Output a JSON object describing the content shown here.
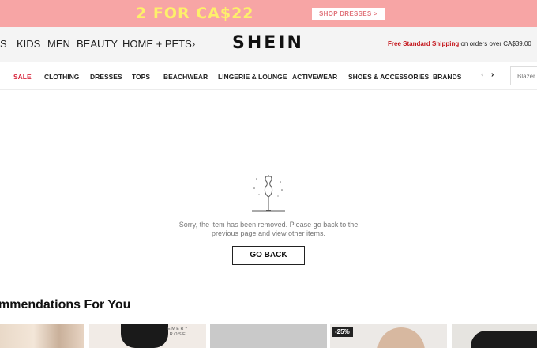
{
  "promo": {
    "headline": "2 FOR CA$22",
    "button_label": "SHOP DRESSES >"
  },
  "header": {
    "nav": [
      "S",
      "KIDS",
      "MEN",
      "BEAUTY",
      "HOME + PETS"
    ],
    "nav_next": "›",
    "logo": "SHEIN",
    "shipping_free": "Free Standard Shipping",
    "shipping_rest": " on orders over CA$39.00"
  },
  "categories": [
    "SALE",
    "CLOTHING",
    "DRESSES",
    "TOPS",
    "BEACHWEAR",
    "LINGERIE & LOUNGE",
    "ACTIVEWEAR",
    "SHOES & ACCESSORIES",
    "BRANDS"
  ],
  "category_nav": {
    "prev": "‹",
    "next": "›"
  },
  "search": {
    "placeholder": "Blazer"
  },
  "empty_state": {
    "message_line1": "Sorry, the item has been removed. Please go back to the",
    "message_line2": "previous page and view other items.",
    "button_label": "GO BACK"
  },
  "recommendations": {
    "title": "mmendations For You",
    "brand_line1": "EMERY",
    "brand_line2": "ROSE",
    "discount_badge": "-25%"
  },
  "colors": {
    "promo_bg": "#f7a5a5",
    "promo_text": "#fdf06a",
    "sale": "#d8263c",
    "shipping_free": "#c4161c"
  },
  "icons": {
    "empty_state": "mannequin-icon"
  }
}
